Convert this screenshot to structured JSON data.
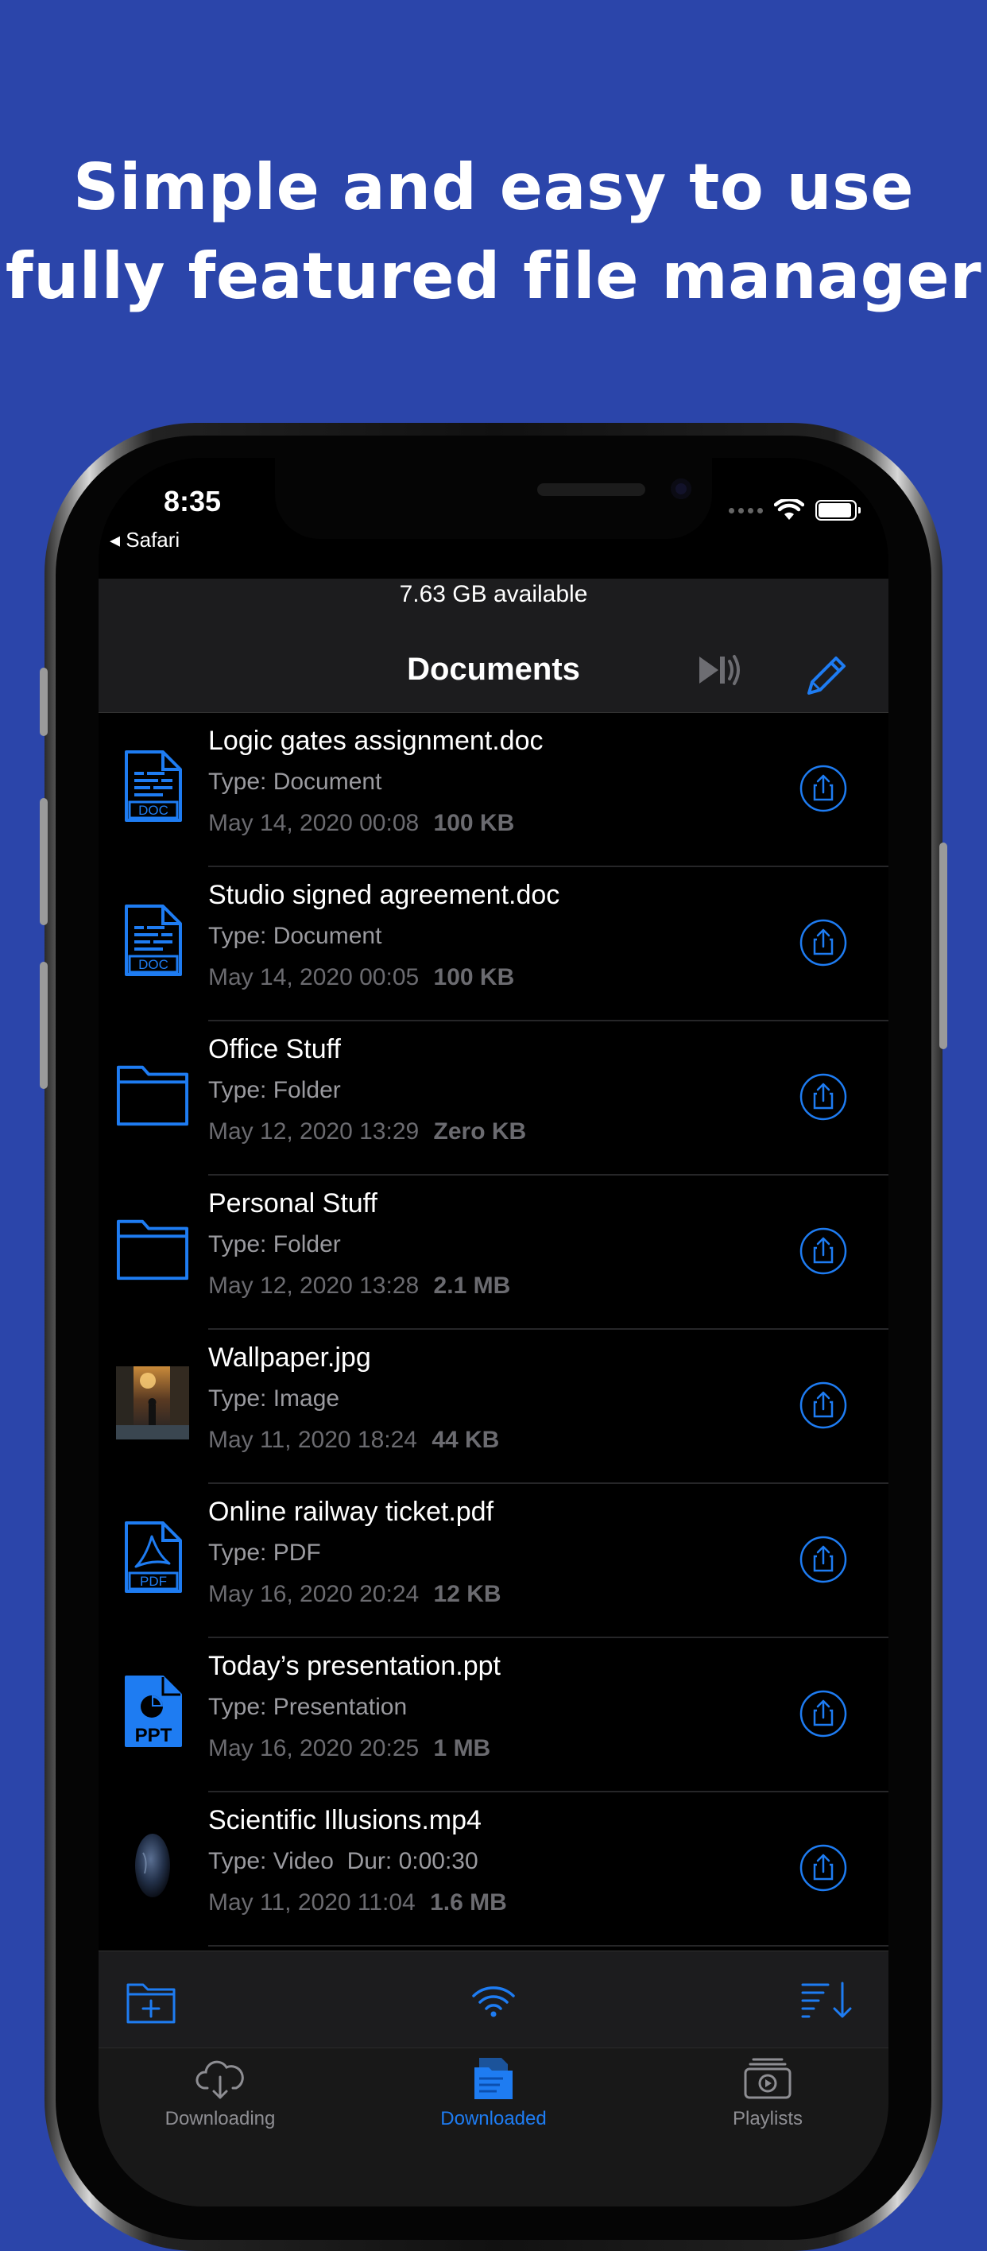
{
  "headline": {
    "line1": "Simple and easy to use",
    "line2": "fully featured file manager"
  },
  "status_bar": {
    "time": "8:35",
    "back_app": "◂ Safari"
  },
  "storage": "7.63 GB available",
  "navbar": {
    "title": "Documents",
    "speak_icon": "speaker-wave-icon",
    "edit_icon": "pencil-icon"
  },
  "files": [
    {
      "name": "Logic gates assignment.doc",
      "type": "Type: Document",
      "date": "May 14, 2020 00:08",
      "size": "100 KB",
      "icon": "doc-icon"
    },
    {
      "name": "Studio signed agreement.doc",
      "type": "Type: Document",
      "date": "May 14, 2020 00:05",
      "size": "100 KB",
      "icon": "doc-icon"
    },
    {
      "name": "Office Stuff",
      "type": "Type: Folder",
      "date": "May 12, 2020 13:29",
      "size": "Zero KB",
      "icon": "folder-icon"
    },
    {
      "name": "Personal Stuff",
      "type": "Type: Folder",
      "date": "May 12, 2020 13:28",
      "size": "2.1 MB",
      "icon": "folder-icon"
    },
    {
      "name": "Wallpaper.jpg",
      "type": "Type: Image",
      "date": "May 11, 2020 18:24",
      "size": "44 KB",
      "icon": "image-thumbnail"
    },
    {
      "name": "Online railway ticket.pdf",
      "type": "Type: PDF",
      "date": "May 16, 2020 20:24",
      "size": "12 KB",
      "icon": "pdf-icon"
    },
    {
      "name": "Today’s presentation.ppt",
      "type": "Type: Presentation",
      "date": "May 16, 2020 20:25",
      "size": "1 MB",
      "icon": "ppt-icon"
    },
    {
      "name": "Scientific Illusions.mp4",
      "type": "Type: Video  Dur: 0:00:30",
      "date": "May 11, 2020 11:04",
      "size": "1.6 MB",
      "icon": "video-thumbnail"
    }
  ],
  "icon_labels": {
    "doc": "DOC",
    "pdf": "PDF",
    "ppt": "PPT"
  },
  "toolbar": {
    "new_folder_icon": "folder-plus-icon",
    "wifi_icon": "wifi-icon",
    "sort_icon": "sort-icon"
  },
  "tabs": [
    {
      "label": "Downloading",
      "icon": "cloud-download-icon",
      "active": false
    },
    {
      "label": "Downloaded",
      "icon": "documents-icon",
      "active": true
    },
    {
      "label": "Playlists",
      "icon": "playlist-icon",
      "active": false
    }
  ],
  "colors": {
    "background": "#2b45aa",
    "accent": "#1e7cf2",
    "screen": "#000000"
  }
}
